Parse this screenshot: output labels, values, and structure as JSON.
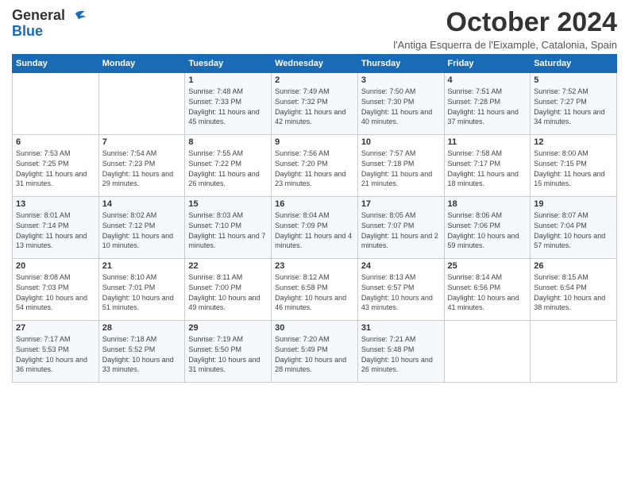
{
  "logo": {
    "general": "General",
    "blue": "Blue"
  },
  "header": {
    "month": "October 2024",
    "location": "l'Antiga Esquerra de l'Eixample, Catalonia, Spain"
  },
  "weekdays": [
    "Sunday",
    "Monday",
    "Tuesday",
    "Wednesday",
    "Thursday",
    "Friday",
    "Saturday"
  ],
  "weeks": [
    [
      {
        "day": "",
        "content": ""
      },
      {
        "day": "",
        "content": ""
      },
      {
        "day": "1",
        "content": "Sunrise: 7:48 AM\nSunset: 7:33 PM\nDaylight: 11 hours and 45 minutes."
      },
      {
        "day": "2",
        "content": "Sunrise: 7:49 AM\nSunset: 7:32 PM\nDaylight: 11 hours and 42 minutes."
      },
      {
        "day": "3",
        "content": "Sunrise: 7:50 AM\nSunset: 7:30 PM\nDaylight: 11 hours and 40 minutes."
      },
      {
        "day": "4",
        "content": "Sunrise: 7:51 AM\nSunset: 7:28 PM\nDaylight: 11 hours and 37 minutes."
      },
      {
        "day": "5",
        "content": "Sunrise: 7:52 AM\nSunset: 7:27 PM\nDaylight: 11 hours and 34 minutes."
      }
    ],
    [
      {
        "day": "6",
        "content": "Sunrise: 7:53 AM\nSunset: 7:25 PM\nDaylight: 11 hours and 31 minutes."
      },
      {
        "day": "7",
        "content": "Sunrise: 7:54 AM\nSunset: 7:23 PM\nDaylight: 11 hours and 29 minutes."
      },
      {
        "day": "8",
        "content": "Sunrise: 7:55 AM\nSunset: 7:22 PM\nDaylight: 11 hours and 26 minutes."
      },
      {
        "day": "9",
        "content": "Sunrise: 7:56 AM\nSunset: 7:20 PM\nDaylight: 11 hours and 23 minutes."
      },
      {
        "day": "10",
        "content": "Sunrise: 7:57 AM\nSunset: 7:18 PM\nDaylight: 11 hours and 21 minutes."
      },
      {
        "day": "11",
        "content": "Sunrise: 7:58 AM\nSunset: 7:17 PM\nDaylight: 11 hours and 18 minutes."
      },
      {
        "day": "12",
        "content": "Sunrise: 8:00 AM\nSunset: 7:15 PM\nDaylight: 11 hours and 15 minutes."
      }
    ],
    [
      {
        "day": "13",
        "content": "Sunrise: 8:01 AM\nSunset: 7:14 PM\nDaylight: 11 hours and 13 minutes."
      },
      {
        "day": "14",
        "content": "Sunrise: 8:02 AM\nSunset: 7:12 PM\nDaylight: 11 hours and 10 minutes."
      },
      {
        "day": "15",
        "content": "Sunrise: 8:03 AM\nSunset: 7:10 PM\nDaylight: 11 hours and 7 minutes."
      },
      {
        "day": "16",
        "content": "Sunrise: 8:04 AM\nSunset: 7:09 PM\nDaylight: 11 hours and 4 minutes."
      },
      {
        "day": "17",
        "content": "Sunrise: 8:05 AM\nSunset: 7:07 PM\nDaylight: 11 hours and 2 minutes."
      },
      {
        "day": "18",
        "content": "Sunrise: 8:06 AM\nSunset: 7:06 PM\nDaylight: 10 hours and 59 minutes."
      },
      {
        "day": "19",
        "content": "Sunrise: 8:07 AM\nSunset: 7:04 PM\nDaylight: 10 hours and 57 minutes."
      }
    ],
    [
      {
        "day": "20",
        "content": "Sunrise: 8:08 AM\nSunset: 7:03 PM\nDaylight: 10 hours and 54 minutes."
      },
      {
        "day": "21",
        "content": "Sunrise: 8:10 AM\nSunset: 7:01 PM\nDaylight: 10 hours and 51 minutes."
      },
      {
        "day": "22",
        "content": "Sunrise: 8:11 AM\nSunset: 7:00 PM\nDaylight: 10 hours and 49 minutes."
      },
      {
        "day": "23",
        "content": "Sunrise: 8:12 AM\nSunset: 6:58 PM\nDaylight: 10 hours and 46 minutes."
      },
      {
        "day": "24",
        "content": "Sunrise: 8:13 AM\nSunset: 6:57 PM\nDaylight: 10 hours and 43 minutes."
      },
      {
        "day": "25",
        "content": "Sunrise: 8:14 AM\nSunset: 6:56 PM\nDaylight: 10 hours and 41 minutes."
      },
      {
        "day": "26",
        "content": "Sunrise: 8:15 AM\nSunset: 6:54 PM\nDaylight: 10 hours and 38 minutes."
      }
    ],
    [
      {
        "day": "27",
        "content": "Sunrise: 7:17 AM\nSunset: 5:53 PM\nDaylight: 10 hours and 36 minutes."
      },
      {
        "day": "28",
        "content": "Sunrise: 7:18 AM\nSunset: 5:52 PM\nDaylight: 10 hours and 33 minutes."
      },
      {
        "day": "29",
        "content": "Sunrise: 7:19 AM\nSunset: 5:50 PM\nDaylight: 10 hours and 31 minutes."
      },
      {
        "day": "30",
        "content": "Sunrise: 7:20 AM\nSunset: 5:49 PM\nDaylight: 10 hours and 28 minutes."
      },
      {
        "day": "31",
        "content": "Sunrise: 7:21 AM\nSunset: 5:48 PM\nDaylight: 10 hours and 26 minutes."
      },
      {
        "day": "",
        "content": ""
      },
      {
        "day": "",
        "content": ""
      }
    ]
  ]
}
